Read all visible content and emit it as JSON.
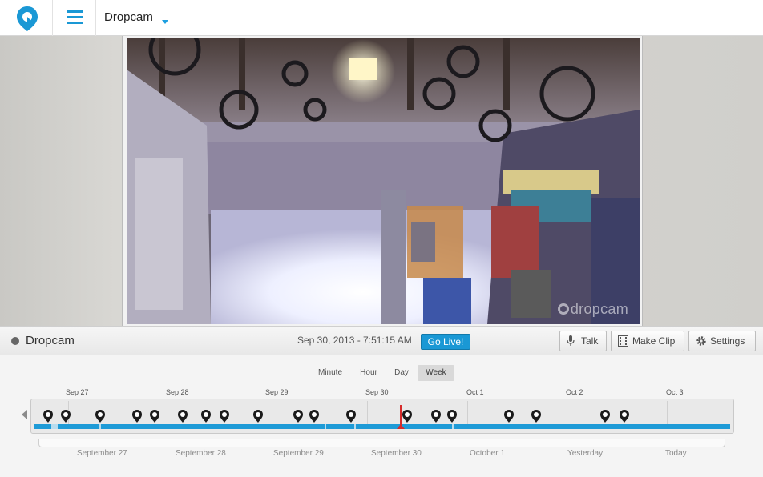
{
  "app": {
    "title": "Dropcam",
    "logo_icon": "location-pin-logo-icon",
    "menu_icon": "hamburger-menu-icon"
  },
  "camera": {
    "name": "Dropcam",
    "watermark": "dropcam"
  },
  "status": {
    "name": "Dropcam",
    "timestamp": "Sep 30, 2013 - 7:51:15 AM",
    "go_live_label": "Go Live!",
    "buttons": {
      "talk": "Talk",
      "make_clip": "Make Clip",
      "settings": "Settings"
    }
  },
  "timeline": {
    "zoom_options": [
      "Minute",
      "Hour",
      "Day",
      "Week"
    ],
    "zoom_selected": "Week",
    "top_dates": [
      "Sep 27",
      "Sep 28",
      "Sep 29",
      "Sep 30",
      "Oct 1",
      "Oct 2",
      "Oct 3"
    ],
    "bottom_labels": [
      "September 27",
      "September 28",
      "September 29",
      "September 30",
      "October 1",
      "Yesterday",
      "Today"
    ]
  },
  "colors": {
    "accent": "#1a98d5",
    "playhead": "#d62b2b",
    "track": "#1e9bd7"
  }
}
